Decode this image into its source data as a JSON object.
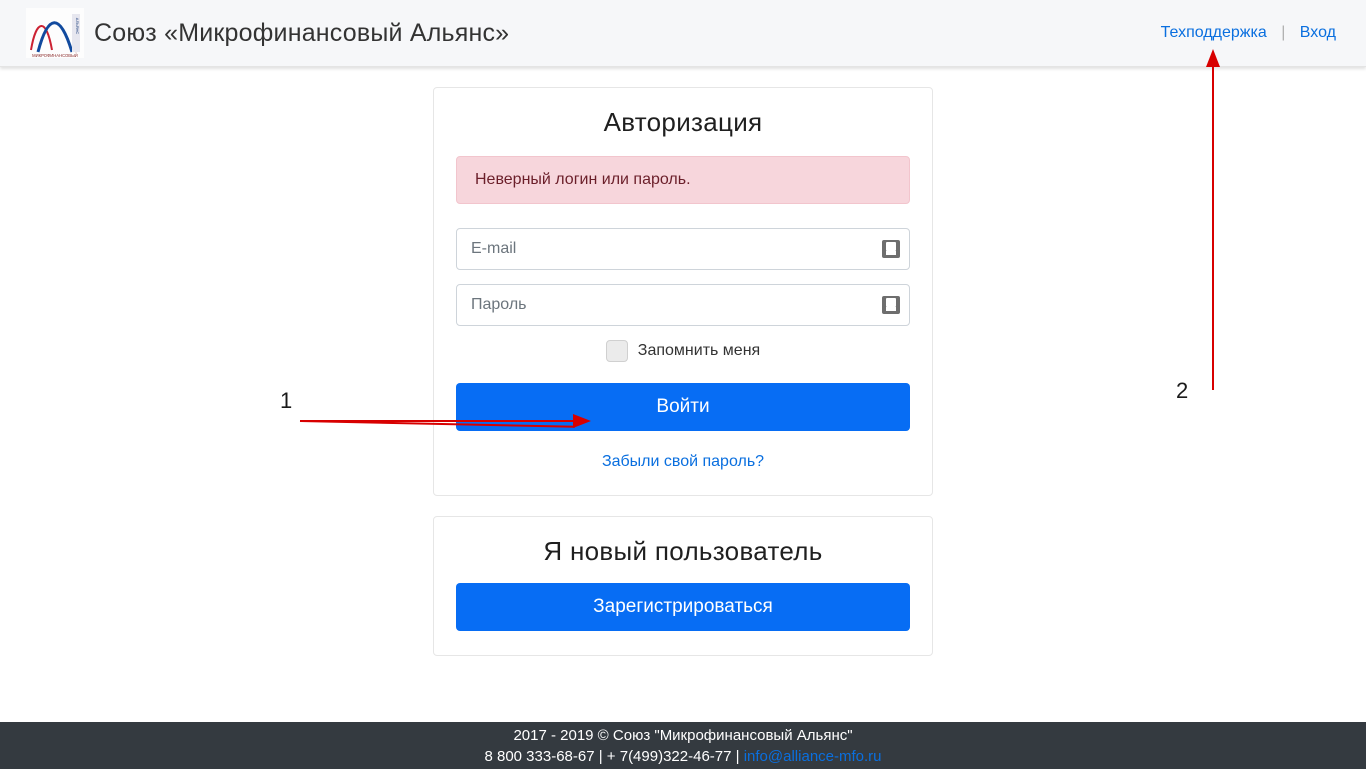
{
  "header": {
    "title": "Союз «Микрофинансовый Альянс»",
    "links": {
      "support": "Техподдержка",
      "login": "Вход"
    }
  },
  "auth": {
    "title": "Авторизация",
    "error": "Неверный логин или пароль.",
    "email_placeholder": "E-mail",
    "password_placeholder": "Пароль",
    "remember": "Запомнить меня",
    "submit": "Войти",
    "forgot": "Забыли свой пароль?"
  },
  "register": {
    "title": "Я новый пользователь",
    "button": "Зарегистрироваться"
  },
  "footer": {
    "line1": "2017 - 2019 © Союз \"Микрофинансовый Альянс\"",
    "phone1": "8 800 333-68-67",
    "phone2": "+ 7(499)322-46-77",
    "email": "info@alliance-mfo.ru",
    "sep": " | "
  },
  "annotations": {
    "n1": "1",
    "n2": "2"
  }
}
